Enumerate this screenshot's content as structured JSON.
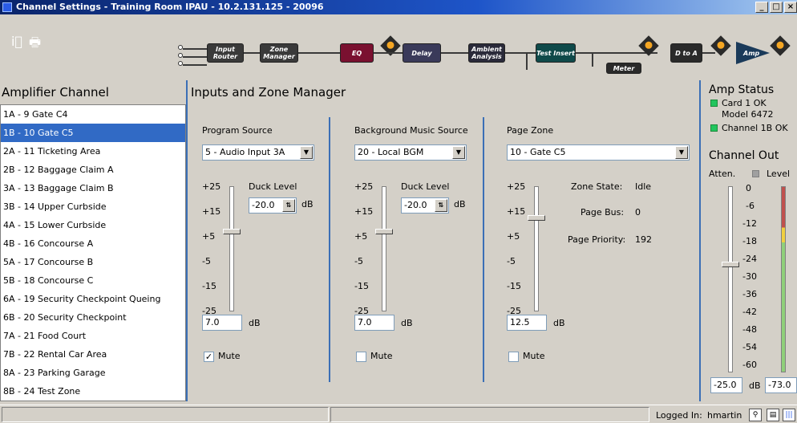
{
  "window": {
    "title": "Channel Settings - Training Room IPAU - 10.2.131.125 - 20096",
    "minimize": "_",
    "maximize": "□",
    "close": "×"
  },
  "pipeline": {
    "blocks": [
      "Input Router",
      "Zone Manager",
      "EQ",
      "Delay",
      "Ambient Analysis",
      "Test Insert",
      "Meter",
      "D to A",
      "Amp"
    ]
  },
  "channel_list": {
    "heading": "Amplifier Channel",
    "selected_index": 1,
    "items": [
      "1A - 9 Gate C4",
      "1B - 10 Gate C5",
      "2A - 11 Ticketing Area",
      "2B - 12 Baggage Claim A",
      "3A - 13 Baggage Claim B",
      "3B - 14 Upper Curbside",
      "4A - 15 Lower Curbside",
      "4B - 16 Concourse A",
      "5A - 17 Concourse B",
      "5B - 18 Concourse C",
      "6A - 19 Security Checkpoint Queing",
      "6B - 20 Security Checkpoint",
      "7A - 21 Food Court",
      "7B - 22 Rental Car Area",
      "8A - 23 Parking Garage",
      "8B - 24 Test Zone"
    ]
  },
  "main": {
    "heading": "Inputs and Zone Manager",
    "scale_labels": [
      "+25",
      "+15",
      "+5",
      "-5",
      "-15",
      "-25"
    ],
    "db_unit": "dB",
    "mute_label": "Mute",
    "duck_label": "Duck Level",
    "program": {
      "label": "Program Source",
      "selected": "5 - Audio Input 3A",
      "duck_value": "-20.0",
      "level_value": "7.0",
      "level_db": 7.0,
      "muted": true
    },
    "bgm": {
      "label": "Background Music Source",
      "selected": "20 - Local BGM",
      "duck_value": "-20.0",
      "level_value": "7.0",
      "level_db": 7.0,
      "muted": false
    },
    "page": {
      "label": "Page Zone",
      "selected": "10 - Gate C5",
      "level_value": "12.5",
      "level_db": 12.5,
      "muted": false,
      "zone_state_label": "Zone State:",
      "zone_state_value": "Idle",
      "page_bus_label": "Page Bus:",
      "page_bus_value": "0",
      "page_priority_label": "Page Priority:",
      "page_priority_value": "192"
    }
  },
  "amp_status": {
    "heading": "Amp Status",
    "card_status": "Card 1 OK",
    "model": "Model 6472",
    "channel_status": "Channel 1B OK",
    "status_color": "#22c55e"
  },
  "channel_out": {
    "heading": "Channel Out",
    "atten_label": "Atten.",
    "level_label": "Level",
    "scale": [
      "0",
      "-6",
      "-12",
      "-18",
      "-24",
      "-30",
      "-36",
      "-42",
      "-48",
      "-54",
      "-60"
    ],
    "atten_value": "-25.0",
    "atten_db": -25.0,
    "unit": "dB",
    "level_value": "-73.0"
  },
  "status_bar": {
    "logged_in_label": "Logged In:",
    "user": "hmartin"
  }
}
